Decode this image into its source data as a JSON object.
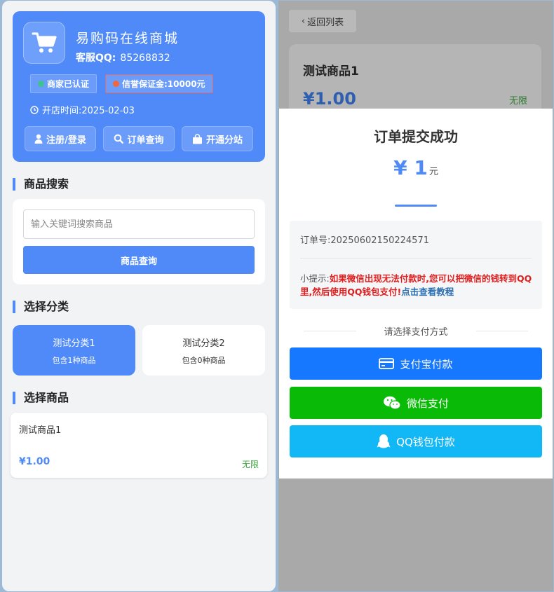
{
  "shop": {
    "name": "易购码在线商城",
    "service_label": "客服QQ:",
    "service_qq": "85268832",
    "badge_verified": "商家已认证",
    "badge_deposit": "信誉保证金:10000元",
    "open_time": "开店时间:2025-02-03",
    "buttons": {
      "login": "注册/登录",
      "order_query": "订单查询",
      "open_branch": "开通分站"
    }
  },
  "search": {
    "title": "商品搜索",
    "placeholder": "输入关键词搜索商品",
    "button": "商品查询"
  },
  "categories": {
    "title": "选择分类",
    "items": [
      {
        "name": "测试分类1",
        "count": "包含1种商品"
      },
      {
        "name": "测试分类2",
        "count": "包含0种商品"
      }
    ]
  },
  "products": {
    "title": "选择商品",
    "items": [
      {
        "name": "测试商品1",
        "price": "¥1.00",
        "stock": "无限"
      }
    ]
  },
  "detail": {
    "back": "返回列表",
    "name": "测试商品1",
    "price": "¥1.00",
    "stock": "无限"
  },
  "modal": {
    "title": "订单提交成功",
    "amount": "¥ 1",
    "unit": "元",
    "order_no": "订单号:20250602150224571",
    "tip_prefix": "小提示:",
    "tip_warn": "如果微信出现无法付款时,您可以把微信的钱转到QQ里,然后使用QQ钱包支付!",
    "tip_link": "点击查看教程",
    "pay_label": "请选择支付方式",
    "pay_alipay": "支付宝付款",
    "pay_wechat": "微信支付",
    "pay_qq": "QQ钱包付款"
  },
  "colors": {
    "primary": "#4f8af8",
    "alipay": "#1677ff",
    "wechat": "#09bb07",
    "qq": "#12b7f5",
    "warn": "#e01e1e"
  }
}
